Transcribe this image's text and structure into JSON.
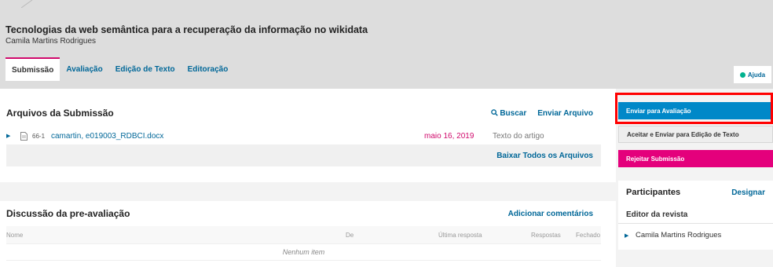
{
  "submission": {
    "title": "Tecnologias da web semântica para a recuperação da informação no wikidata",
    "author": "Camila Martins Rodrigues"
  },
  "tabs": [
    {
      "label": "Submissão",
      "active": true
    },
    {
      "label": "Avaliação",
      "active": false
    },
    {
      "label": "Edição de Texto",
      "active": false
    },
    {
      "label": "Editoração",
      "active": false
    }
  ],
  "help": {
    "label": "Ajuda",
    "icon": "help-circle-icon"
  },
  "files_panel": {
    "title": "Arquivos da Submissão",
    "search_label": "Buscar",
    "upload_label": "Enviar Arquivo",
    "download_all_label": "Baixar Todos os Arquivos",
    "file": {
      "id": "66-1",
      "name": "camartin, e019003_RDBCI.docx",
      "date": "maio 16, 2019",
      "type": "Texto do artigo"
    }
  },
  "discussion_panel": {
    "title": "Discussão da pre-avaliação",
    "add_label": "Adicionar comentários",
    "columns": [
      "Nome",
      "De",
      "Última resposta",
      "Respostas",
      "Fechado"
    ],
    "empty_label": "Nenhum item"
  },
  "actions": {
    "send_review": "Enviar para Avaliação",
    "accept_copyedit": "Aceitar e Enviar para Edição de Texto",
    "reject": "Rejeitar Submissão"
  },
  "participants": {
    "title": "Participantes",
    "assign_label": "Designar",
    "group": "Editor da revista",
    "members": [
      "Camila Martins Rodrigues"
    ]
  },
  "colors": {
    "link": "#006798",
    "primary": "#0088c8",
    "danger": "#e4007c",
    "tab_accent": "#d00a6c",
    "highlight": "#ff0000"
  }
}
